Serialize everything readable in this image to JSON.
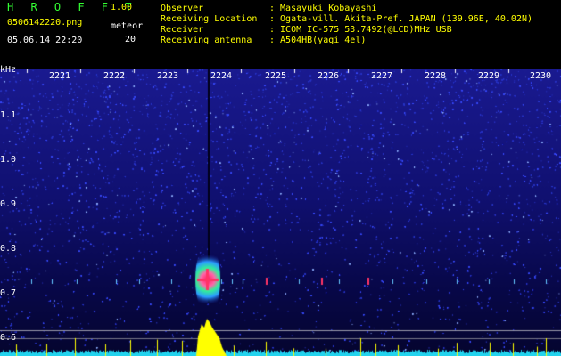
{
  "header": {
    "app_title": "H R O F F T",
    "version": "1.00",
    "file_name": "0506142220.png",
    "meteor_label": "meteor",
    "meteor_count": "20",
    "datetime": "05.06.14 22:20"
  },
  "info": [
    {
      "key": "Observer",
      "value": ": Masayuki Kobayashi"
    },
    {
      "key": "Receiving Location",
      "value": ": Ogata-vill. Akita-Pref. JAPAN (139.96E, 40.02N)"
    },
    {
      "key": "Receiver",
      "value": ": ICOM IC-575 53.7492(@LCD)MHz USB"
    },
    {
      "key": "Receiving antenna",
      "value": ": A504HB(yagi 4el)"
    }
  ],
  "spectrogram": {
    "unit": "kHz",
    "time_labels": [
      "2221",
      "2222",
      "2223",
      "2224",
      "2225",
      "2226",
      "2227",
      "2228",
      "2229",
      "2230"
    ],
    "freq_labels": [
      "1.1",
      "1.0",
      "0.9",
      "0.8",
      "0.7",
      "0.6"
    ],
    "colors": {
      "background": "#0a0a5a",
      "noise": "#3344ff",
      "echo": "#ff3366",
      "trace": "#ffff00",
      "baseline": "#22d3ee"
    }
  }
}
